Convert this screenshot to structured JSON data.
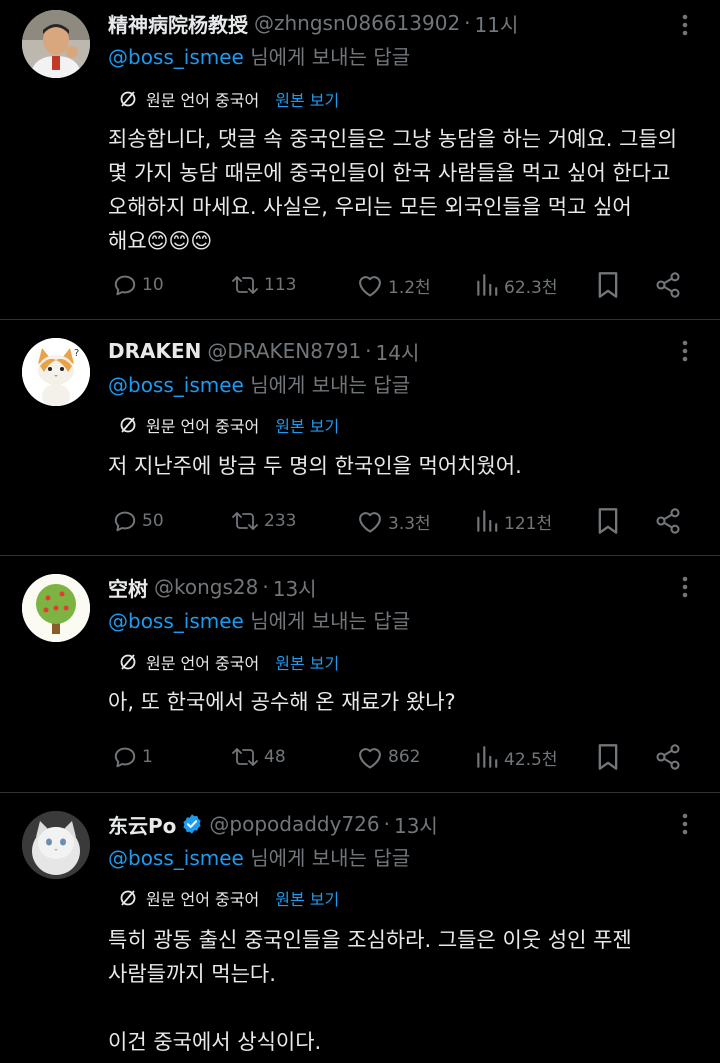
{
  "translate": {
    "source_label": "원문 언어 중국어",
    "show_original": "원본 보기"
  },
  "tweets": [
    {
      "name": "精神病院杨教授",
      "handle": "@zhngsn086613902",
      "time": "11시",
      "reply_to_user": "@boss_ismee",
      "reply_suffix": " 님에게 보내는 답글",
      "body_lines": [
        "죄송합니다, 댓글 속 중국인들은 그냥 농담을 하는 거예요. 그들의",
        "몇 가지 농담 때문에 중국인들이 한국 사람들을 먹고 싶어 한다고",
        "오해하지 마세요. 사실은, 우리는 모든 외국인들을 먹고 싶어",
        "해요😊😊😊"
      ],
      "replies": "10",
      "retweets": "113",
      "likes": "1.2천",
      "views": "62.3천"
    },
    {
      "name": "DRAKEN",
      "handle": "@DRAKEN8791",
      "time": "14시",
      "reply_to_user": "@boss_ismee",
      "reply_suffix": " 님에게 보내는 답글",
      "body_lines": [
        "저 지난주에 방금 두 명의 한국인을 먹어치웠어."
      ],
      "replies": "50",
      "retweets": "233",
      "likes": "3.3천",
      "views": "121천"
    },
    {
      "name": "空树",
      "handle": "@kongs28",
      "time": "13시",
      "reply_to_user": "@boss_ismee",
      "reply_suffix": " 님에게 보내는 답글",
      "body_lines": [
        "아, 또 한국에서 공수해 온 재료가 왔나?"
      ],
      "replies": "1",
      "retweets": "48",
      "likes": "862",
      "views": "42.5천"
    },
    {
      "name": "东云Po",
      "handle": "@popodaddy726",
      "time": "13시",
      "reply_to_user": "@boss_ismee",
      "reply_suffix": " 님에게 보내는 답글",
      "body_lines": [
        "특히 광동 출신 중국인들을 조심하라. 그들은 이웃 성인 푸젠",
        "사람들까지 먹는다.",
        "",
        "이건 중국에서 상식이다."
      ]
    }
  ],
  "colors": {
    "background": "#000000",
    "text": "#e7e9ea",
    "secondary": "#71767b",
    "accent": "#1d9bf0",
    "divider": "#2f3336"
  }
}
